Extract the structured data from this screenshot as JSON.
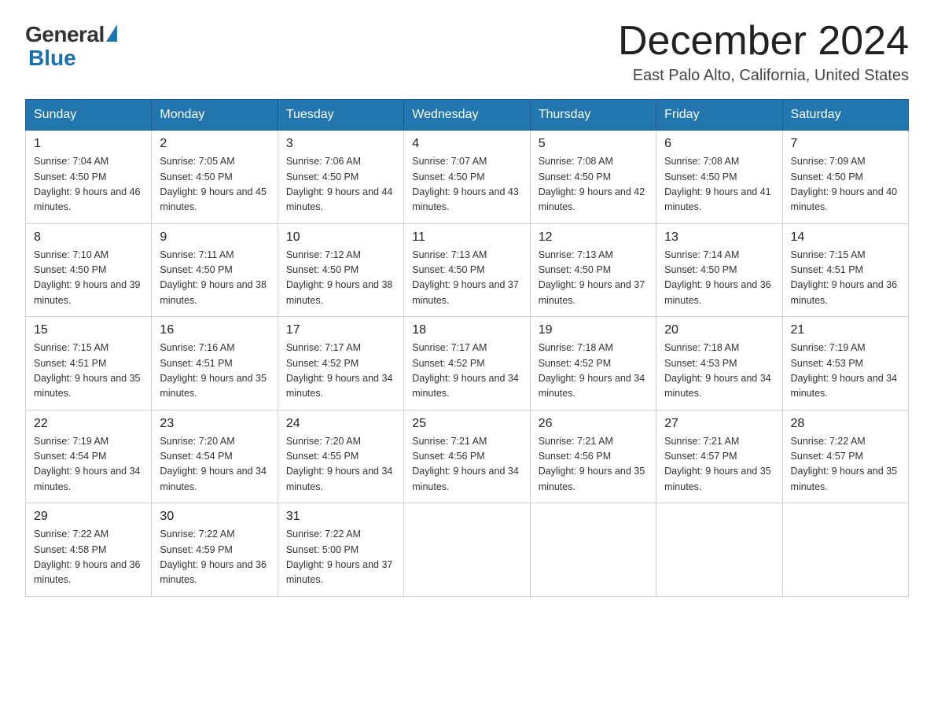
{
  "header": {
    "logo_general": "General",
    "logo_blue": "Blue",
    "month_year": "December 2024",
    "location": "East Palo Alto, California, United States"
  },
  "weekdays": [
    "Sunday",
    "Monday",
    "Tuesday",
    "Wednesday",
    "Thursday",
    "Friday",
    "Saturday"
  ],
  "weeks": [
    [
      {
        "day": "1",
        "sunrise": "7:04 AM",
        "sunset": "4:50 PM",
        "daylight": "9 hours and 46 minutes."
      },
      {
        "day": "2",
        "sunrise": "7:05 AM",
        "sunset": "4:50 PM",
        "daylight": "9 hours and 45 minutes."
      },
      {
        "day": "3",
        "sunrise": "7:06 AM",
        "sunset": "4:50 PM",
        "daylight": "9 hours and 44 minutes."
      },
      {
        "day": "4",
        "sunrise": "7:07 AM",
        "sunset": "4:50 PM",
        "daylight": "9 hours and 43 minutes."
      },
      {
        "day": "5",
        "sunrise": "7:08 AM",
        "sunset": "4:50 PM",
        "daylight": "9 hours and 42 minutes."
      },
      {
        "day": "6",
        "sunrise": "7:08 AM",
        "sunset": "4:50 PM",
        "daylight": "9 hours and 41 minutes."
      },
      {
        "day": "7",
        "sunrise": "7:09 AM",
        "sunset": "4:50 PM",
        "daylight": "9 hours and 40 minutes."
      }
    ],
    [
      {
        "day": "8",
        "sunrise": "7:10 AM",
        "sunset": "4:50 PM",
        "daylight": "9 hours and 39 minutes."
      },
      {
        "day": "9",
        "sunrise": "7:11 AM",
        "sunset": "4:50 PM",
        "daylight": "9 hours and 38 minutes."
      },
      {
        "day": "10",
        "sunrise": "7:12 AM",
        "sunset": "4:50 PM",
        "daylight": "9 hours and 38 minutes."
      },
      {
        "day": "11",
        "sunrise": "7:13 AM",
        "sunset": "4:50 PM",
        "daylight": "9 hours and 37 minutes."
      },
      {
        "day": "12",
        "sunrise": "7:13 AM",
        "sunset": "4:50 PM",
        "daylight": "9 hours and 37 minutes."
      },
      {
        "day": "13",
        "sunrise": "7:14 AM",
        "sunset": "4:50 PM",
        "daylight": "9 hours and 36 minutes."
      },
      {
        "day": "14",
        "sunrise": "7:15 AM",
        "sunset": "4:51 PM",
        "daylight": "9 hours and 36 minutes."
      }
    ],
    [
      {
        "day": "15",
        "sunrise": "7:15 AM",
        "sunset": "4:51 PM",
        "daylight": "9 hours and 35 minutes."
      },
      {
        "day": "16",
        "sunrise": "7:16 AM",
        "sunset": "4:51 PM",
        "daylight": "9 hours and 35 minutes."
      },
      {
        "day": "17",
        "sunrise": "7:17 AM",
        "sunset": "4:52 PM",
        "daylight": "9 hours and 34 minutes."
      },
      {
        "day": "18",
        "sunrise": "7:17 AM",
        "sunset": "4:52 PM",
        "daylight": "9 hours and 34 minutes."
      },
      {
        "day": "19",
        "sunrise": "7:18 AM",
        "sunset": "4:52 PM",
        "daylight": "9 hours and 34 minutes."
      },
      {
        "day": "20",
        "sunrise": "7:18 AM",
        "sunset": "4:53 PM",
        "daylight": "9 hours and 34 minutes."
      },
      {
        "day": "21",
        "sunrise": "7:19 AM",
        "sunset": "4:53 PM",
        "daylight": "9 hours and 34 minutes."
      }
    ],
    [
      {
        "day": "22",
        "sunrise": "7:19 AM",
        "sunset": "4:54 PM",
        "daylight": "9 hours and 34 minutes."
      },
      {
        "day": "23",
        "sunrise": "7:20 AM",
        "sunset": "4:54 PM",
        "daylight": "9 hours and 34 minutes."
      },
      {
        "day": "24",
        "sunrise": "7:20 AM",
        "sunset": "4:55 PM",
        "daylight": "9 hours and 34 minutes."
      },
      {
        "day": "25",
        "sunrise": "7:21 AM",
        "sunset": "4:56 PM",
        "daylight": "9 hours and 34 minutes."
      },
      {
        "day": "26",
        "sunrise": "7:21 AM",
        "sunset": "4:56 PM",
        "daylight": "9 hours and 35 minutes."
      },
      {
        "day": "27",
        "sunrise": "7:21 AM",
        "sunset": "4:57 PM",
        "daylight": "9 hours and 35 minutes."
      },
      {
        "day": "28",
        "sunrise": "7:22 AM",
        "sunset": "4:57 PM",
        "daylight": "9 hours and 35 minutes."
      }
    ],
    [
      {
        "day": "29",
        "sunrise": "7:22 AM",
        "sunset": "4:58 PM",
        "daylight": "9 hours and 36 minutes."
      },
      {
        "day": "30",
        "sunrise": "7:22 AM",
        "sunset": "4:59 PM",
        "daylight": "9 hours and 36 minutes."
      },
      {
        "day": "31",
        "sunrise": "7:22 AM",
        "sunset": "5:00 PM",
        "daylight": "9 hours and 37 minutes."
      },
      null,
      null,
      null,
      null
    ]
  ]
}
